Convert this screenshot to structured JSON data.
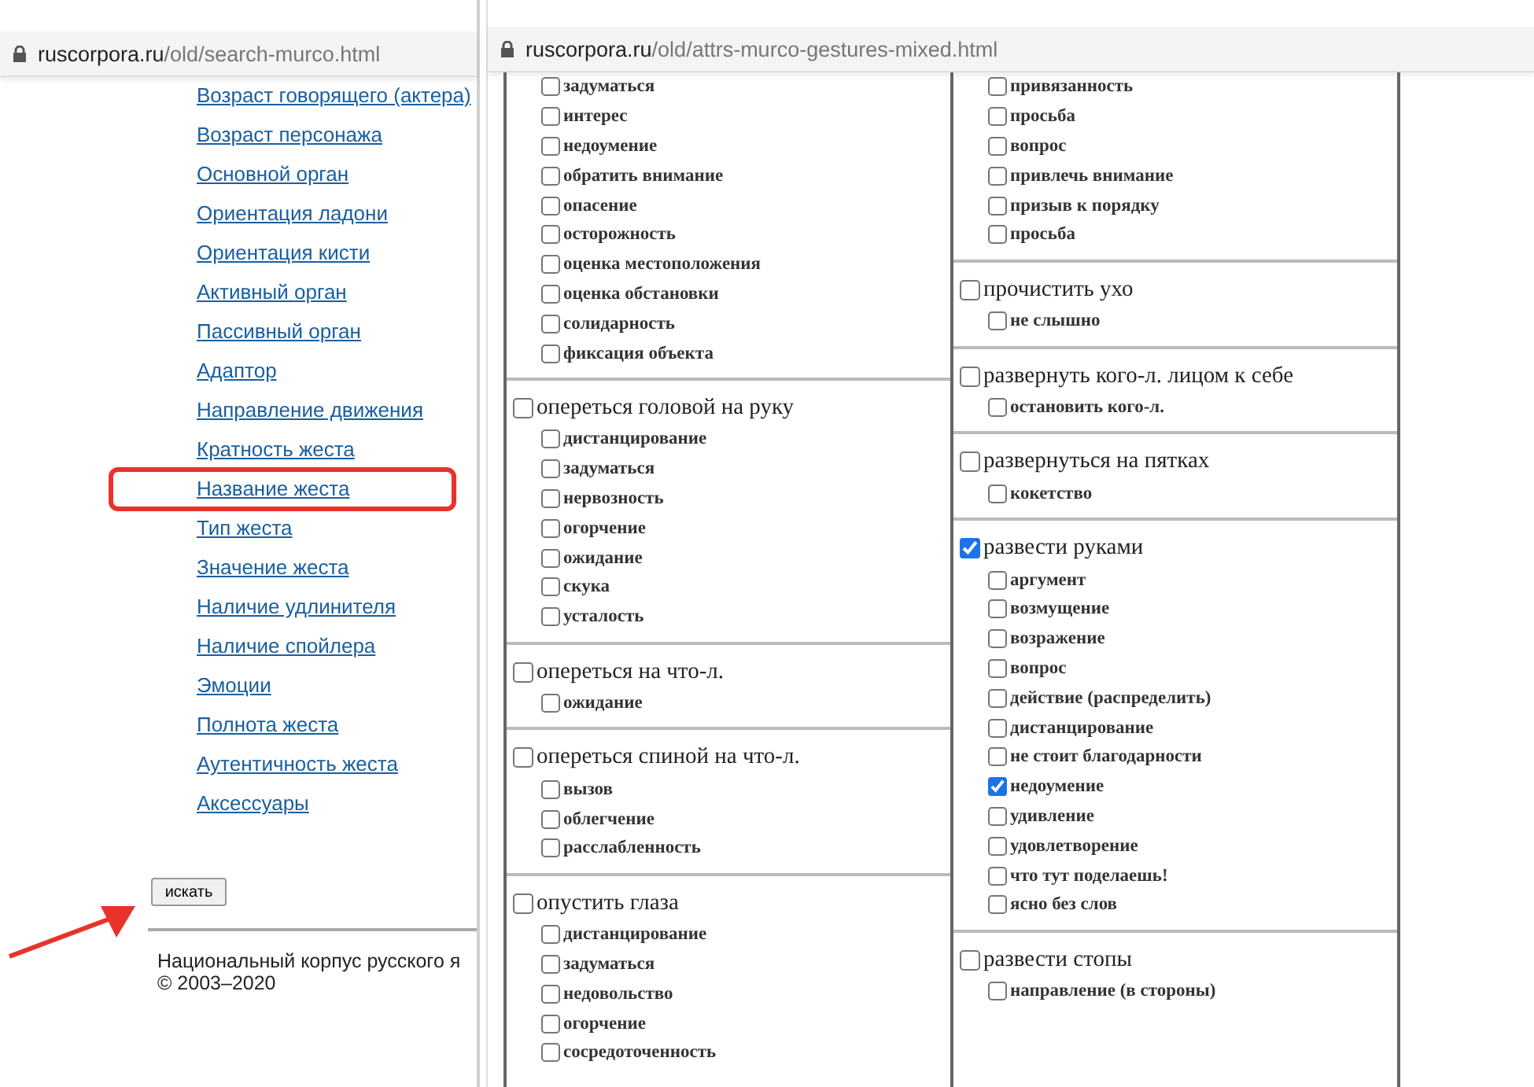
{
  "left_window": {
    "address": {
      "host": "ruscorpora.ru",
      "path": "/old/search-murco.html"
    },
    "links": [
      {
        "label": "Возраст говорящего (актера)",
        "highlighted": false
      },
      {
        "label": "Возраст персонажа",
        "highlighted": false
      },
      {
        "label": "Основной орган",
        "highlighted": false
      },
      {
        "label": "Ориентация ладони",
        "highlighted": false
      },
      {
        "label": "Ориентация кисти",
        "highlighted": false
      },
      {
        "label": "Активный орган",
        "highlighted": false
      },
      {
        "label": "Пассивный орган",
        "highlighted": false
      },
      {
        "label": "Адаптор",
        "highlighted": false
      },
      {
        "label": "Направление движения",
        "highlighted": false
      },
      {
        "label": "Кратность жеста",
        "highlighted": false
      },
      {
        "label": "Название жеста",
        "highlighted": true
      },
      {
        "label": "Тип жеста",
        "highlighted": false
      },
      {
        "label": "Значение жеста",
        "highlighted": false
      },
      {
        "label": "Наличие удлинителя",
        "highlighted": false
      },
      {
        "label": "Наличие спойлера",
        "highlighted": false
      },
      {
        "label": "Эмоции",
        "highlighted": false
      },
      {
        "label": "Полнота жеста",
        "highlighted": false
      },
      {
        "label": "Аутентичность жеста",
        "highlighted": false
      },
      {
        "label": "Аксессуары",
        "highlighted": false
      }
    ],
    "search_button": "искать",
    "footer": [
      "Национальный корпус русского я",
      "© 2003–2020"
    ]
  },
  "right_window": {
    "address": {
      "host": "ruscorpora.ru",
      "path": "/old/attrs-murco-gestures-mixed.html"
    },
    "columns": [
      {
        "groups": [
          {
            "items": [
              {
                "label": "задуматься",
                "checked": false
              },
              {
                "label": "интерес",
                "checked": false
              },
              {
                "label": "недоумение",
                "checked": false
              },
              {
                "label": "обратить внимание",
                "checked": false
              },
              {
                "label": "опасение",
                "checked": false
              },
              {
                "label": "осторожность",
                "checked": false
              },
              {
                "label": "оценка местоположения",
                "checked": false
              },
              {
                "label": "оценка обстановки",
                "checked": false
              },
              {
                "label": "солидарность",
                "checked": false
              },
              {
                "label": "фиксация объекта",
                "checked": false
              }
            ]
          },
          {
            "label": "опереться головой на руку",
            "checked": false,
            "items": [
              {
                "label": "дистанцирование",
                "checked": false
              },
              {
                "label": "задуматься",
                "checked": false
              },
              {
                "label": "нервозность",
                "checked": false
              },
              {
                "label": "огорчение",
                "checked": false
              },
              {
                "label": "ожидание",
                "checked": false
              },
              {
                "label": "скука",
                "checked": false
              },
              {
                "label": "усталость",
                "checked": false
              }
            ]
          },
          {
            "label": "опереться на что-л.",
            "checked": false,
            "items": [
              {
                "label": "ожидание",
                "checked": false
              }
            ]
          },
          {
            "label": "опереться спиной на что-л.",
            "checked": false,
            "items": [
              {
                "label": "вызов",
                "checked": false
              },
              {
                "label": "облегчение",
                "checked": false
              },
              {
                "label": "расслабленность",
                "checked": false
              }
            ]
          },
          {
            "label": "опустить глаза",
            "checked": false,
            "items": [
              {
                "label": "дистанцирование",
                "checked": false
              },
              {
                "label": "задуматься",
                "checked": false
              },
              {
                "label": "недовольство",
                "checked": false
              },
              {
                "label": "огорчение",
                "checked": false
              },
              {
                "label": "сосредоточенность",
                "checked": false
              }
            ]
          }
        ]
      },
      {
        "groups": [
          {
            "items": [
              {
                "label": "привязанность",
                "checked": false
              },
              {
                "label": "просьба",
                "checked": false
              },
              {
                "label": "вопрос",
                "checked": false
              },
              {
                "label": "привлечь внимание",
                "checked": false
              },
              {
                "label": "призыв к порядку",
                "checked": false
              },
              {
                "label": "просьба",
                "checked": false
              }
            ]
          },
          {
            "label": "прочистить ухо",
            "checked": false,
            "items": [
              {
                "label": "не слышно",
                "checked": false
              }
            ]
          },
          {
            "label": "развернуть кого-л. лицом к себе",
            "checked": false,
            "items": [
              {
                "label": "остановить кого-л.",
                "checked": false
              }
            ]
          },
          {
            "label": "развернуться на пятках",
            "checked": false,
            "items": [
              {
                "label": "кокетство",
                "checked": false
              }
            ]
          },
          {
            "label": "развести руками",
            "checked": true,
            "items": [
              {
                "label": "аргумент",
                "checked": false
              },
              {
                "label": "возмущение",
                "checked": false
              },
              {
                "label": "возражение",
                "checked": false
              },
              {
                "label": "вопрос",
                "checked": false
              },
              {
                "label": "действие (распределить)",
                "checked": false
              },
              {
                "label": "дистанцирование",
                "checked": false
              },
              {
                "label": "не стоит благодарности",
                "checked": false
              },
              {
                "label": "недоумение",
                "checked": true
              },
              {
                "label": "удивление",
                "checked": false
              },
              {
                "label": "удовлетворение",
                "checked": false
              },
              {
                "label": "что тут поделаешь!",
                "checked": false
              },
              {
                "label": "ясно без слов",
                "checked": false
              }
            ]
          },
          {
            "label": "развести стопы",
            "checked": false,
            "items": [
              {
                "label": "направление (в стороны)",
                "checked": false
              }
            ]
          }
        ]
      }
    ]
  }
}
